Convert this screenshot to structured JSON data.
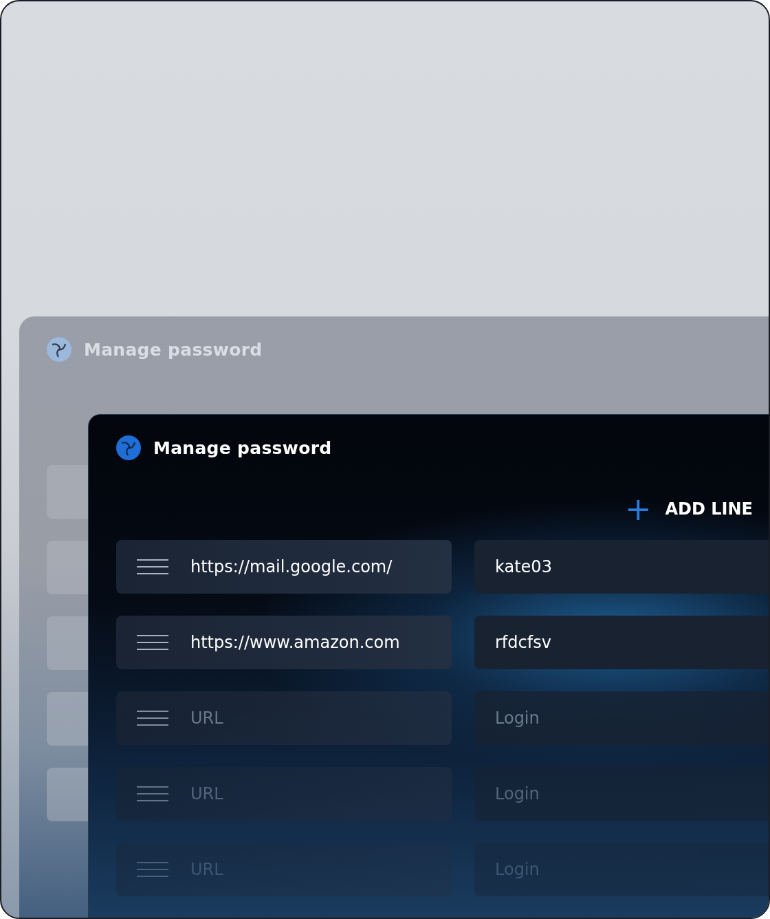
{
  "back_window": {
    "title": "Manage password"
  },
  "front_window": {
    "title": "Manage password",
    "add_button": {
      "icon": "+",
      "label": "ADD LINE"
    },
    "rows": [
      {
        "url": {
          "value": "https://mail.google.com/"
        },
        "login": {
          "value": "kate03"
        }
      },
      {
        "url": {
          "value": "https://www.amazon.com"
        },
        "login": {
          "value": "rfdcfsv"
        }
      },
      {
        "url": {
          "placeholder": "URL"
        },
        "login": {
          "placeholder": "Login"
        }
      },
      {
        "url": {
          "placeholder": "URL"
        },
        "login": {
          "placeholder": "Login"
        }
      },
      {
        "url": {
          "placeholder": "URL"
        },
        "login": {
          "placeholder": "Login"
        }
      }
    ]
  }
}
